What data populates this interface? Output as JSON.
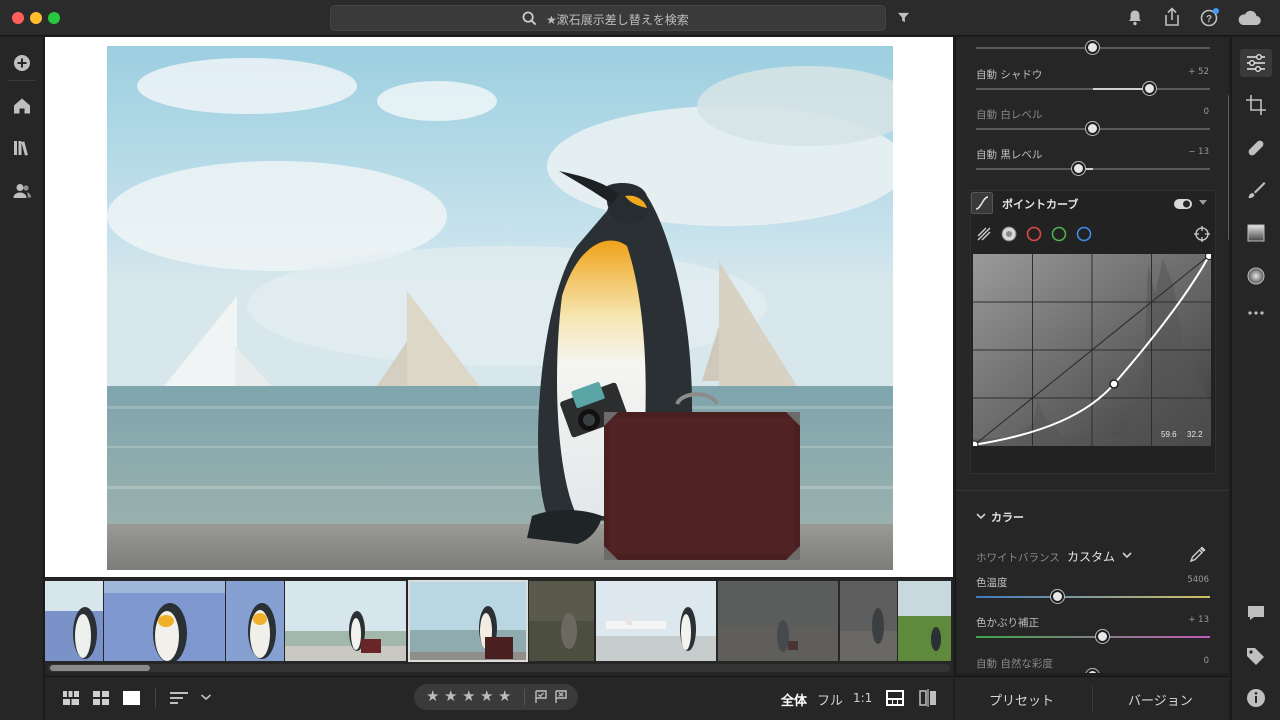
{
  "search": {
    "placeholder": "★漱石展示差し替えを検索"
  },
  "colors": {
    "accent": "#3b9ef5",
    "panel_bg": "#262626",
    "knob": "#e6e6e6"
  },
  "edit_panel": {
    "sliders_top": [
      {
        "label": "",
        "value": "",
        "fraction": 0.5
      },
      {
        "label": "自動 シャドウ",
        "value": "+ 52",
        "fraction": 0.74
      },
      {
        "label": "自動 白レベル",
        "value": "0",
        "fraction": 0.5
      },
      {
        "label": "自動 黒レベル",
        "value": "− 13",
        "fraction": 0.44
      }
    ],
    "point_curve": {
      "title": "ポイントカーブ",
      "readout_in": "59.6",
      "readout_out": "32.2",
      "channels": [
        "parametric",
        "rgb",
        "red",
        "green",
        "blue"
      ]
    },
    "color": {
      "title": "カラー",
      "white_balance_label": "ホワイトバランス",
      "white_balance_value": "カスタム",
      "temp_label": "色温度",
      "temp_value": "5406",
      "temp_fraction": 0.35,
      "tint_label": "色かぶり補正",
      "tint_value": "+ 13",
      "tint_fraction": 0.54,
      "vibrance_label": "自動 自然な彩度",
      "vibrance_value": "0"
    }
  },
  "bottom_bar": {
    "view_all": "全体",
    "view_full": "フル",
    "view_1to1": "1:1",
    "stars": [
      "★",
      "★",
      "★",
      "★",
      "★"
    ]
  },
  "panel_buttons": {
    "presets": "プリセット",
    "versions": "バージョン"
  }
}
